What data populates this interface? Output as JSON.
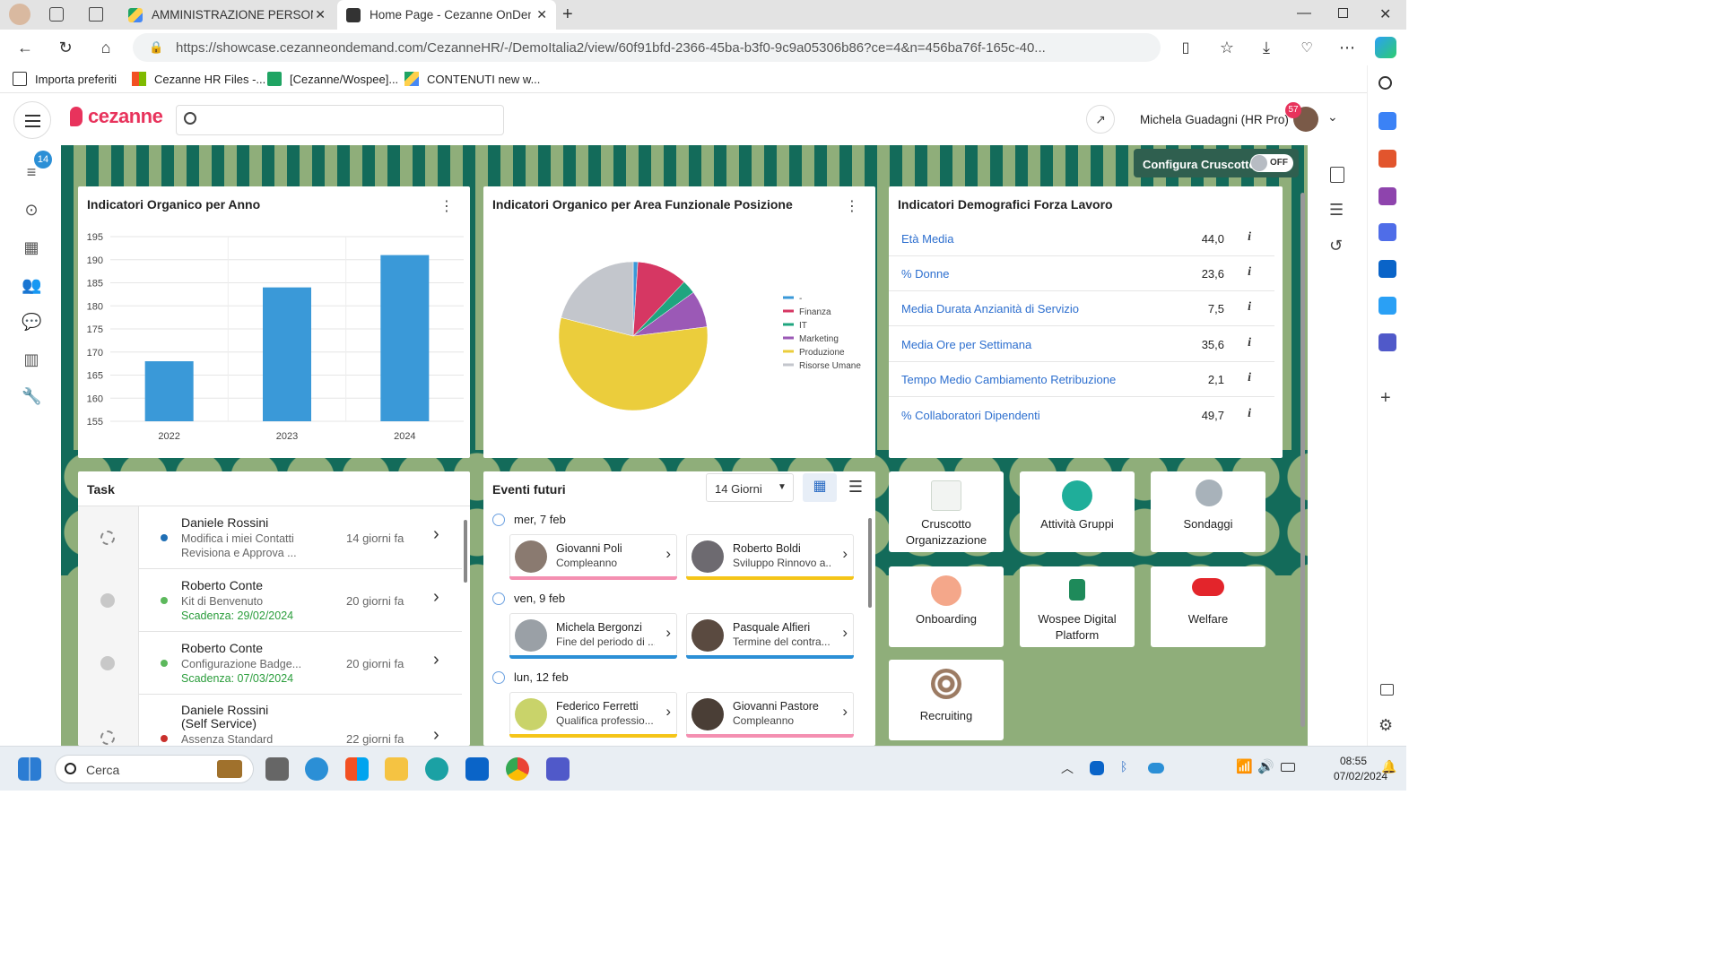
{
  "browser": {
    "tabs": [
      {
        "title": "AMMINISTRAZIONE PERSONALE",
        "active": false
      },
      {
        "title": "Home Page - Cezanne OnDemand",
        "active": true
      }
    ],
    "url": "https://showcase.cezanneondemand.com/CezanneHR/-/DemoItalia2/view/60f91bfd-2366-45ba-b3f0-9c9a05306b86?ce=4&n=456ba76f-165c-40...",
    "favorites": [
      "Importa preferiti",
      "Cezanne HR Files -...",
      "[Cezanne/Wospee]...",
      "CONTENUTI new w..."
    ]
  },
  "app": {
    "logo": "cezanne",
    "user_name": "Michela Guadagni (HR Pro)",
    "notification_count": "57",
    "rail_badge": "14",
    "configure_label": "Configura Cruscotto",
    "configure_toggle": "OFF"
  },
  "bar_card": {
    "title": "Indicatori Organico per Anno"
  },
  "pie_card": {
    "title": "Indicatori Organico per Area Funzionale Posizione"
  },
  "demo_card": {
    "title": "Indicatori Demografici Forza Lavoro",
    "rows": [
      {
        "label": "Età Media",
        "value": "44,0"
      },
      {
        "label": "% Donne",
        "value": "23,6"
      },
      {
        "label": "Media Durata Anzianità di Servizio",
        "value": "7,5"
      },
      {
        "label": "Media Ore per Settimana",
        "value": "35,6"
      },
      {
        "label": "Tempo Medio Cambiamento Retribuzione",
        "value": "2,1"
      },
      {
        "label": "% Collaboratori Dipendenti",
        "value": "49,7"
      }
    ]
  },
  "tasks": {
    "title": "Task",
    "items": [
      {
        "name": "Daniele Rossini",
        "desc": "Modifica i miei Contatti Revisiona e Approva ...",
        "due": "",
        "ago": "14 giorni fa",
        "dot": "#1f6fb5",
        "status": "pending"
      },
      {
        "name": "Roberto Conte",
        "desc": "Kit di Benvenuto",
        "due": "Scadenza: 29/02/2024",
        "ago": "20 giorni fa",
        "dot": "#5cb85c",
        "status": "idle"
      },
      {
        "name": "Roberto Conte",
        "desc": "Configurazione Badge...",
        "due": "Scadenza: 07/03/2024",
        "ago": "20 giorni fa",
        "dot": "#5cb85c",
        "status": "idle"
      },
      {
        "name": "Daniele Rossini (Self Service)",
        "desc": "Assenza Standard",
        "due": "",
        "ago": "22 giorni fa",
        "dot": "#c9302c",
        "status": "pending"
      }
    ]
  },
  "events": {
    "title": "Eventi futuri",
    "range": "14 Giorni",
    "days": [
      {
        "label": "mer, 7 feb",
        "cards": [
          {
            "name": "Giovanni Poli",
            "desc": "Compleanno",
            "color": "#f48fb1"
          },
          {
            "name": "Roberto Boldi",
            "desc": "Sviluppo Rinnovo a...",
            "color": "#f5c518"
          }
        ]
      },
      {
        "label": "ven, 9 feb",
        "cards": [
          {
            "name": "Michela Bergonzi",
            "desc": "Fine del periodo di ...",
            "color": "#2b8fd6"
          },
          {
            "name": "Pasquale Alfieri",
            "desc": "Termine del contra...",
            "color": "#2b8fd6"
          }
        ]
      },
      {
        "label": "lun, 12 feb",
        "cards": [
          {
            "name": "Federico Ferretti",
            "desc": "Qualifica professio...",
            "color": "#f5c518"
          },
          {
            "name": "Giovanni Pastore",
            "desc": "Compleanno",
            "color": "#f48fb1"
          }
        ]
      }
    ]
  },
  "tiles": [
    {
      "label": "Cruscotto Organizzazione"
    },
    {
      "label": "Attività Gruppi"
    },
    {
      "label": "Sondaggi"
    },
    {
      "label": "Onboarding"
    },
    {
      "label": "Wospee Digital Platform"
    },
    {
      "label": "Welfare"
    },
    {
      "label": "Recruiting"
    }
  ],
  "taskbar": {
    "search": "Cerca",
    "time": "08:55",
    "date": "07/02/2024"
  },
  "chart_data": [
    {
      "type": "bar",
      "categories": [
        "2022",
        "2023",
        "2024"
      ],
      "values": [
        168,
        184,
        191
      ],
      "ylim": [
        155,
        195
      ],
      "yticks": [
        155,
        160,
        165,
        170,
        175,
        180,
        185,
        190,
        195
      ],
      "color": "#3a99d8",
      "grid": true
    },
    {
      "type": "pie",
      "labels": [
        "-",
        "Finanza",
        "IT",
        "Marketing",
        "Produzione",
        "Risorse Umane"
      ],
      "values": [
        1,
        11,
        3,
        8,
        56,
        21
      ],
      "colors": [
        "#3a99d8",
        "#d63763",
        "#1fa57f",
        "#9b59b6",
        "#ebcd3c",
        "#c3c6cc"
      ],
      "legend": "right"
    }
  ]
}
